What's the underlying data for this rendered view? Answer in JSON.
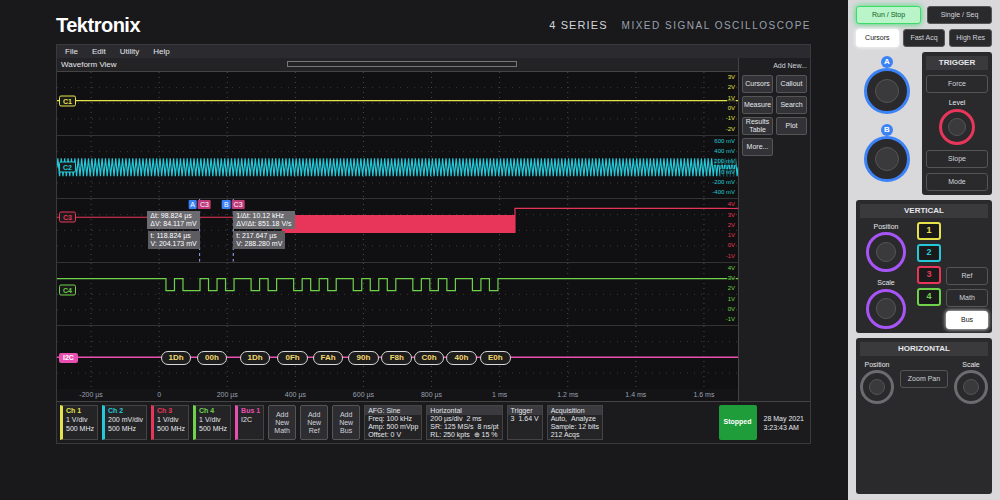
{
  "brand": {
    "logo": "Tektronix",
    "series": "4 SERIES",
    "model": "MIXED SIGNAL OSCILLOSCOPE"
  },
  "menu": [
    "File",
    "Edit",
    "Utility",
    "Help"
  ],
  "view": {
    "title": "Waveform View"
  },
  "side_panel": {
    "title": "Add New...",
    "buttons": [
      "Cursors",
      "Callout",
      "Measure",
      "Search",
      "Results Table",
      "Plot",
      "More..."
    ]
  },
  "channels": [
    {
      "label": "C1",
      "color": "#e6e34a",
      "kind": "flat",
      "vdiv": 1,
      "level_v": 0.25,
      "scale_labels": [
        "3V",
        "2V",
        "1V",
        "0V",
        "-1V",
        "-2V"
      ]
    },
    {
      "label": "C2",
      "color": "#25c8d8",
      "kind": "sine",
      "vdiv": 0.2,
      "amplitude_v": 0.17,
      "freq_khz": 100,
      "scale_labels": [
        "600 mV",
        "400 mV",
        "200 mV",
        "0 mV",
        "-200 mV",
        "-400 mV"
      ]
    },
    {
      "label": "C3",
      "color": "#e8355a",
      "kind": "burst",
      "vdiv": 1,
      "idle_v": 1.25,
      "high_v": 1.4,
      "low_v": -0.2,
      "after_v": 2.1,
      "start_us": 360,
      "end_us": 1045,
      "period_us": 5,
      "scale_labels": [
        "4V",
        "3V",
        "2V",
        "1V",
        "0V",
        "-1V"
      ]
    },
    {
      "label": "C4",
      "color": "#6fd24a",
      "kind": "digital",
      "vdiv": 1,
      "high_v": 1.5,
      "low_v": 0.35,
      "idle": 1,
      "start_us": 20,
      "step_us": 25,
      "samples": [
        0,
        1,
        0,
        0,
        1,
        0,
        1,
        0,
        1,
        1,
        0,
        1,
        0,
        1,
        1,
        0,
        1,
        0,
        1,
        0,
        1,
        1,
        0,
        1,
        0,
        1,
        0,
        1,
        1,
        0,
        1,
        0,
        1,
        0,
        1,
        1,
        0,
        1,
        0,
        1
      ],
      "scale_labels": [
        "4V",
        "3V",
        "2V",
        "1V",
        "0V",
        "-1V"
      ]
    }
  ],
  "bus": {
    "label": "I2C",
    "color": "#e84fb0",
    "segments": [
      {
        "label": "1Dh",
        "start_us": 5,
        "end_us": 95
      },
      {
        "label": "00h",
        "start_us": 110,
        "end_us": 200
      },
      {
        "label": "1Dh",
        "start_us": 237,
        "end_us": 327
      },
      {
        "label": "0Fh",
        "start_us": 347,
        "end_us": 437
      },
      {
        "label": "FAh",
        "start_us": 451,
        "end_us": 541
      },
      {
        "label": "90h",
        "start_us": 555,
        "end_us": 645
      },
      {
        "label": "F8h",
        "start_us": 653,
        "end_us": 743
      },
      {
        "label": "C0h",
        "start_us": 748,
        "end_us": 838
      },
      {
        "label": "40h",
        "start_us": 843,
        "end_us": 933
      },
      {
        "label": "E0h",
        "start_us": 942,
        "end_us": 1032
      }
    ]
  },
  "cursors": [
    {
      "name": "A",
      "source": "C3",
      "position_us": 118.824,
      "readout": [
        "t: 118.824 µs",
        "V: 204.173 mV"
      ]
    },
    {
      "name": "B",
      "source": "C3",
      "position_us": 217.647,
      "readout": [
        "t: 217.647 µs",
        "V: 288.280 mV"
      ]
    }
  ],
  "cursor_deltas": [
    [
      "Δt: 98.824 µs",
      "ΔV: 84.117 mV"
    ],
    [
      "1/Δt: 10.12 kHz",
      "ΔV/Δt: 851.18 V/s"
    ]
  ],
  "time_axis": [
    {
      "label": "-200 µs",
      "t_us": -200
    },
    {
      "label": "0",
      "t_us": 0
    },
    {
      "label": "200 µs",
      "t_us": 200
    },
    {
      "label": "400 µs",
      "t_us": 400
    },
    {
      "label": "600 µs",
      "t_us": 600
    },
    {
      "label": "800 µs",
      "t_us": 800
    },
    {
      "label": "1 ms",
      "t_us": 1000
    },
    {
      "label": "1.2 ms",
      "t_us": 1200
    },
    {
      "label": "1.4 ms",
      "t_us": 1400
    },
    {
      "label": "1.6 ms",
      "t_us": 1600
    }
  ],
  "badges": [
    {
      "title": "Ch 1",
      "color": "#e6e34a",
      "lines": [
        "1 V/div",
        "500 MHz"
      ]
    },
    {
      "title": "Ch 2",
      "color": "#25c8d8",
      "lines": [
        "200 mV/div",
        "500 MHz"
      ]
    },
    {
      "title": "Ch 3",
      "color": "#e8355a",
      "lines": [
        "1 V/div",
        "500 MHz"
      ]
    },
    {
      "title": "Ch 4",
      "color": "#6fd24a",
      "lines": [
        "1 V/div",
        "500 MHz"
      ]
    },
    {
      "title": "Bus 1",
      "color": "#e84fb0",
      "lines": [
        "I2C"
      ]
    }
  ],
  "add_buttons": [
    "Add New Math",
    "Add New Ref",
    "Add New Bus"
  ],
  "info": [
    {
      "title": "AFG: Sine",
      "lines": [
        [
          "Freq: 100 kHz"
        ],
        [
          "Amp: 500 mVpp"
        ],
        [
          "Offset: 0 V"
        ]
      ]
    },
    {
      "title": "Horizontal",
      "lines": [
        [
          "200 µs/div",
          "2 ms"
        ],
        [
          "SR: 125 MS/s",
          "8 ns/pt"
        ],
        [
          "RL: 250 kpts",
          "⊕ 15 %"
        ]
      ]
    },
    {
      "title": "Trigger",
      "lines": [
        [
          "3",
          "1.64 V"
        ]
      ]
    },
    {
      "title": "Acquisition",
      "lines": [
        [
          "Auto,",
          "Analyze"
        ],
        [
          "Sample: 12 bits"
        ],
        [
          "212 Acqs"
        ]
      ]
    }
  ],
  "status": "Stopped",
  "datetime": [
    "28 May 2021",
    "3:23:43 AM"
  ],
  "controls": {
    "top": [
      {
        "label": "Run / Stop",
        "lit": true
      },
      {
        "label": "Single / Seq",
        "lit": false
      }
    ],
    "small": [
      {
        "label": "Cursors",
        "lit": true
      },
      {
        "label": "Fast Acq",
        "lit": false
      },
      {
        "label": "High Res",
        "lit": false
      }
    ],
    "knobs": [
      "A",
      "B"
    ],
    "trigger": {
      "title": "TRIGGER",
      "buttons": [
        "Force",
        "Slope",
        "Mode"
      ],
      "knob": "Level"
    },
    "vertical": {
      "title": "VERTICAL",
      "knobs": [
        "Position",
        "Scale"
      ],
      "channels": [
        {
          "label": "1",
          "color": "#e6e34a",
          "lit": true
        },
        {
          "label": "2",
          "color": "#25c8d8",
          "lit": true
        },
        {
          "label": "3",
          "color": "#e8355a",
          "lit": true
        },
        {
          "label": "4",
          "color": "#6fd24a",
          "lit": true
        }
      ],
      "buttons": [
        {
          "label": "Ref",
          "lit": false
        },
        {
          "label": "Math",
          "lit": false
        },
        {
          "label": "Bus",
          "lit": true
        }
      ]
    },
    "horizontal": {
      "title": "HORIZONTAL",
      "knobs": [
        "Position",
        "Scale"
      ],
      "button": "Zoom Pan"
    }
  }
}
